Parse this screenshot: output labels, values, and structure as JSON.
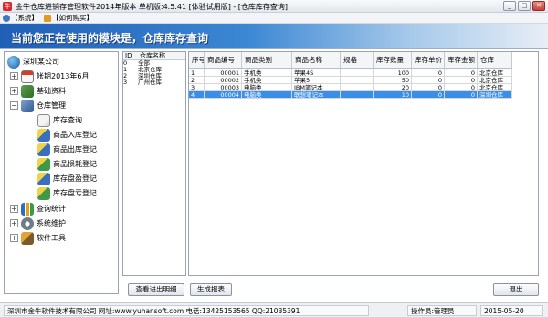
{
  "window": {
    "title": "金牛仓库进销存管理软件2014年版本 单机版:4.5.41 [体验试用版] - [仓库库存查询]",
    "controls": [
      "minimize-icon",
      "restore-icon",
      "close-icon"
    ]
  },
  "menubar": {
    "items": [
      {
        "label": "【系统】",
        "icon": "system-icon"
      },
      {
        "label": "【如何购买】",
        "icon": "cart-icon"
      }
    ]
  },
  "banner": {
    "text": "当前您正在使用的模块是，仓库库存查询"
  },
  "tree": {
    "root": "深圳某公司",
    "items": [
      {
        "label": "帐期2013年6月",
        "expander": "+",
        "icon": "calendar-icon"
      },
      {
        "label": "基础资料",
        "expander": "+",
        "icon": "book-icon"
      },
      {
        "label": "仓库管理",
        "expander": "−",
        "icon": "warehouse-icon"
      },
      {
        "label": "库存查询",
        "icon": "document-icon"
      },
      {
        "label": "商品入库登记",
        "icon": "pen-icon"
      },
      {
        "label": "商品出库登记",
        "icon": "pen-icon"
      },
      {
        "label": "商品损耗登记",
        "icon": "pen-icon"
      },
      {
        "label": "库存盘盈登记",
        "icon": "pen-icon"
      },
      {
        "label": "库存盘亏登记",
        "icon": "pen-icon"
      },
      {
        "label": "查询统计",
        "expander": "+",
        "icon": "chart-icon"
      },
      {
        "label": "系统维护",
        "expander": "+",
        "icon": "gear-icon"
      },
      {
        "label": "软件工具",
        "expander": "+",
        "icon": "tools-icon"
      }
    ]
  },
  "stores": {
    "headers": [
      "ID",
      "仓库名称"
    ],
    "rows": [
      [
        "0",
        "全部"
      ],
      [
        "1",
        "北京仓库"
      ],
      [
        "2",
        "深圳仓库"
      ],
      [
        "3",
        "广州仓库"
      ]
    ]
  },
  "grid": {
    "columns": [
      "序号",
      "商品编号",
      "商品类别",
      "商品名称",
      "规格",
      "库存数量",
      "库存单价",
      "库存金额",
      "仓库"
    ],
    "rows": [
      [
        "1",
        "00001",
        "手机类",
        "苹果4S",
        "",
        "100",
        "0",
        "0",
        "北京仓库"
      ],
      [
        "2",
        "00002",
        "手机类",
        "苹果5",
        "",
        "50",
        "0",
        "0",
        "北京仓库"
      ],
      [
        "3",
        "00003",
        "电脑类",
        "IBM笔记本",
        "",
        "20",
        "0",
        "0",
        "北京仓库"
      ],
      [
        "4",
        "00004",
        "电脑类",
        "联想笔记本",
        "",
        "10",
        "0",
        "0",
        "深圳仓库"
      ]
    ],
    "selected_row": 3
  },
  "buttons": {
    "view_detail": "查看进出明细",
    "report": "生成报表",
    "exit": "退出"
  },
  "status": {
    "company": "深圳市金牛软件技术有限公司 网址:www.yuhansoft.com 电话:13425153565 QQ:21035391",
    "operator": "操作员:管理员",
    "date": "2015-05-20"
  }
}
